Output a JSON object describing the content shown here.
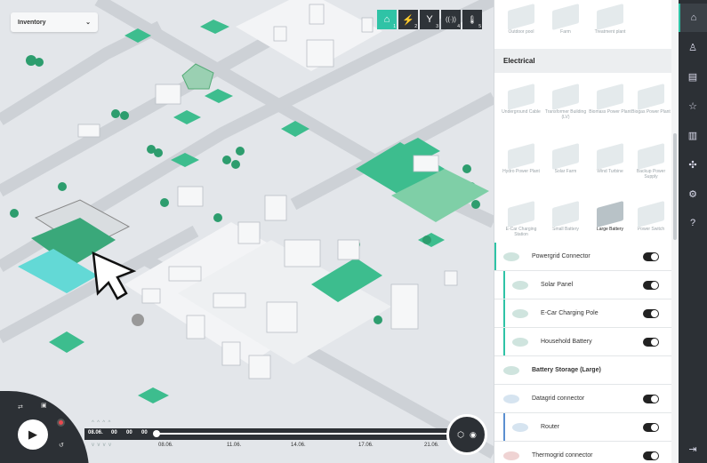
{
  "inventory": {
    "label": "Inventory"
  },
  "topnav": [
    {
      "icon": "home-icon",
      "num": "1",
      "glyph": "⌂",
      "active": true
    },
    {
      "icon": "lightning-icon",
      "num": "2",
      "glyph": "⚡"
    },
    {
      "icon": "antenna-icon",
      "num": "3",
      "glyph": "Y"
    },
    {
      "icon": "signal-icon",
      "num": "4",
      "glyph": "((·))"
    },
    {
      "icon": "thermometer-icon",
      "num": "5",
      "glyph": "🌡"
    }
  ],
  "timeline": {
    "day": "08.06.",
    "hour": "00",
    "minute": "00",
    "second": "00",
    "ticks": [
      "08.06.",
      "11.06.",
      "14.06.",
      "17.06.",
      "21.06."
    ],
    "play_glyph": "▶"
  },
  "panel": {
    "top_items": [
      "Outdoor pool",
      "Farm",
      "Treatment plant"
    ],
    "section_title": "Electrical",
    "electrical_items": [
      {
        "label": "Underground Cable"
      },
      {
        "label": "Transformer Building (LV)"
      },
      {
        "label": "Biomass Power Plant"
      },
      {
        "label": "Biogas Power Plant"
      },
      {
        "label": "Hydro Power Plant"
      },
      {
        "label": "Solar Farm"
      },
      {
        "label": "Wind Turbine"
      },
      {
        "label": "Backup Power Supply"
      },
      {
        "label": "E-Car Charging Station"
      },
      {
        "label": "Small Battery"
      },
      {
        "label": "Large Battery",
        "selected": true
      },
      {
        "label": "Power Switch"
      }
    ],
    "rows": [
      {
        "label": "Powergrid Connector",
        "bold": true,
        "toggle": true
      },
      {
        "label": "Solar Panel",
        "toggle": true,
        "sub": true
      },
      {
        "label": "E-Car Charging Pole",
        "toggle": true,
        "sub": true
      },
      {
        "label": "Household Battery",
        "toggle": true,
        "sub": true
      },
      {
        "label": "Battery Storage (Large)",
        "bold": true,
        "toggle": false
      },
      {
        "label": "Datagrid connector",
        "toggle": true
      },
      {
        "label": "Router",
        "toggle": true,
        "sub": true
      },
      {
        "label": "Thermogrid connector",
        "toggle": true
      }
    ]
  },
  "rail": [
    {
      "icon": "city-icon",
      "glyph": "⌂",
      "active": true
    },
    {
      "icon": "person-icon",
      "glyph": "♙"
    },
    {
      "icon": "calendar-icon",
      "glyph": "▤"
    },
    {
      "icon": "star-icon",
      "glyph": "☆"
    },
    {
      "icon": "buildings-icon",
      "glyph": "▥"
    },
    {
      "icon": "puzzle-icon",
      "glyph": "✣"
    },
    {
      "icon": "gear-icon",
      "glyph": "⚙"
    },
    {
      "icon": "help-icon",
      "glyph": "?"
    },
    {
      "icon": "logout-icon",
      "glyph": "⇥"
    }
  ],
  "colors": {
    "accent": "#2fc3a6",
    "dark": "#2c3035",
    "grass": "#3dbd8e"
  }
}
